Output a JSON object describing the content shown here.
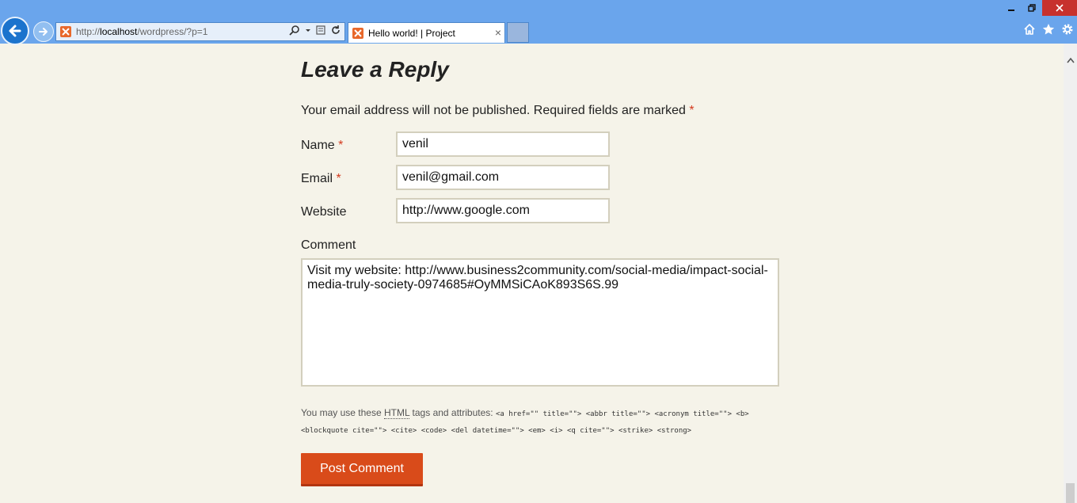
{
  "browser": {
    "address": {
      "prefix": "http://",
      "host": "localhost",
      "path": "/wordpress/?p=1"
    },
    "tab": {
      "title": "Hello world! | Project",
      "close_glyph": "×"
    },
    "window_controls": {
      "minimize": "–",
      "restore": "❐",
      "close": "✕"
    },
    "accent_colors": {
      "chrome": "#6aa5ec",
      "back_button": "#1b73cd",
      "close_button": "#c7312d",
      "favicon": "#e8682b"
    },
    "icons": [
      "back-arrow-icon",
      "forward-arrow-icon",
      "search-icon",
      "dropdown-icon",
      "compat-view-icon",
      "refresh-icon",
      "home-icon",
      "favorites-star-icon",
      "settings-gear-icon"
    ]
  },
  "form": {
    "heading": "Leave a Reply",
    "notes": "Your email address will not be published. Required fields are marked",
    "required_mark": "*",
    "fields": {
      "name": {
        "label": "Name",
        "value": "venil"
      },
      "email": {
        "label": "Email",
        "value": "venil@gmail.com"
      },
      "website": {
        "label": "Website",
        "value": "http://www.google.com"
      }
    },
    "comment": {
      "label": "Comment",
      "value": "Visit my website: http://www.business2community.com/social-media/impact-social-media-truly-society-0974685#OyMMSiCAoK893S6S.99"
    },
    "allowed_tags": {
      "prefix": "You may use these",
      "abbr": "HTML",
      "suffix": "tags and attributes:",
      "code": "<a href=\"\" title=\"\"> <abbr title=\"\"> <acronym title=\"\"> <b> <blockquote cite=\"\"> <cite> <code> <del datetime=\"\"> <em> <i> <q cite=\"\"> <strike> <strong>"
    },
    "submit_label": "Post Comment",
    "submit_color": "#d94b1a",
    "required_color": "#d33a1e"
  }
}
